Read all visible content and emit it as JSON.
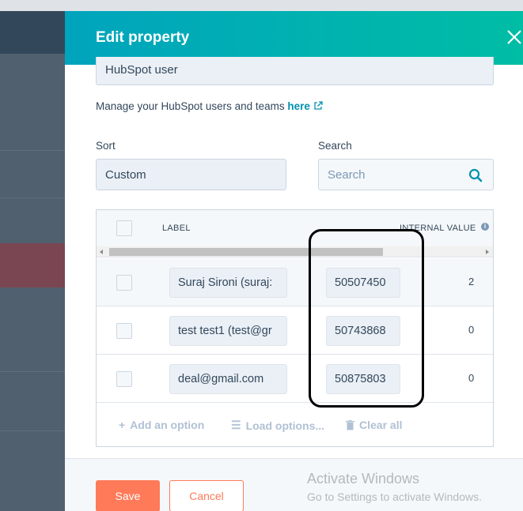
{
  "panel": {
    "title": "Edit property",
    "field_value": "HubSpot user",
    "manage_text": "Manage your HubSpot users and teams ",
    "manage_link": "here"
  },
  "sort": {
    "label": "Sort",
    "value": "Custom"
  },
  "search": {
    "label": "Search",
    "placeholder": "Search"
  },
  "table": {
    "columns": {
      "label": "LABEL",
      "internal_value": "INTERNAL VALUE"
    },
    "rows": [
      {
        "label": "Suraj Sironi (suraj:",
        "internal_value": "50507450",
        "num": "2"
      },
      {
        "label": "test test1 (test@gr",
        "internal_value": "50743868",
        "num": "0"
      },
      {
        "label": "deal@gmail.com",
        "internal_value": "50875803",
        "num": "0"
      }
    ],
    "actions": {
      "add": "Add an option",
      "load": "Load options...",
      "clear": "Clear all"
    }
  },
  "footer": {
    "save": "Save",
    "cancel": "Cancel",
    "activate_title": "Activate Windows",
    "activate_sub": "Go to Settings to activate Windows."
  },
  "colors": {
    "header_gradient_start": "#00a4bd",
    "header_gradient_end": "#00bda5",
    "accent": "#ff7a59",
    "link": "#0091ae"
  }
}
